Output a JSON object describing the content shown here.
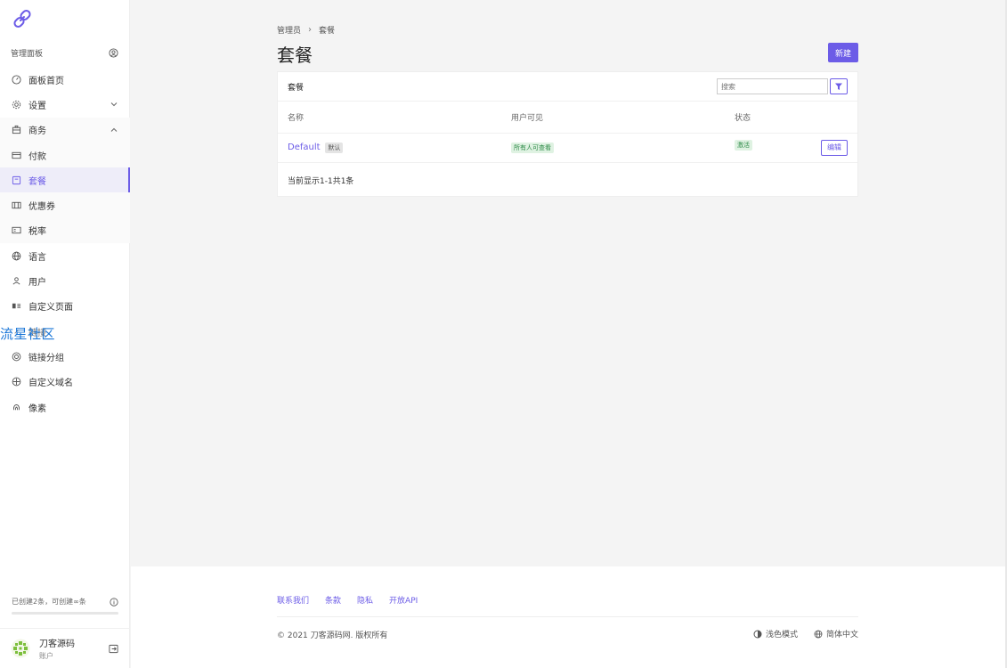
{
  "sidebar": {
    "panel_title": "管理面板",
    "items": [
      {
        "label": "面板首页"
      },
      {
        "label": "设置"
      },
      {
        "label": "商务"
      },
      {
        "label": "付款"
      },
      {
        "label": "套餐"
      },
      {
        "label": "优惠券"
      },
      {
        "label": "税率"
      },
      {
        "label": "语言"
      },
      {
        "label": "用户"
      },
      {
        "label": "自定义页面"
      },
      {
        "label": "链接"
      },
      {
        "label": "链接分组"
      },
      {
        "label": "自定义域名"
      },
      {
        "label": "像素"
      }
    ],
    "watermark": "流星社区",
    "usage_text": "已创建2条，可创建∞条",
    "account_name": "刀客源码",
    "account_role": "账户"
  },
  "main": {
    "breadcrumb": [
      "管理员",
      "套餐"
    ],
    "breadcrumb_sep": "›",
    "title": "套餐",
    "new_button": "新建",
    "card": {
      "title": "套餐",
      "search_placeholder": "搜索",
      "columns": [
        "名称",
        "用户可见",
        "状态"
      ],
      "rows": [
        {
          "name": "Default",
          "name_tag": "默认",
          "visibility": "所有人可查看",
          "status": "激活",
          "action": "编辑"
        }
      ],
      "summary": "当前显示1-1共1条"
    }
  },
  "footer": {
    "links": [
      "联系我们",
      "条款",
      "隐私",
      "开放API"
    ],
    "copyright": "© 2021 刀客源码网. 版权所有",
    "theme": "浅色模式",
    "language": "简体中文"
  },
  "colors": {
    "accent": "#6c5ce7",
    "watermark": "#1e78d8",
    "status_green": "#2e8b48"
  }
}
